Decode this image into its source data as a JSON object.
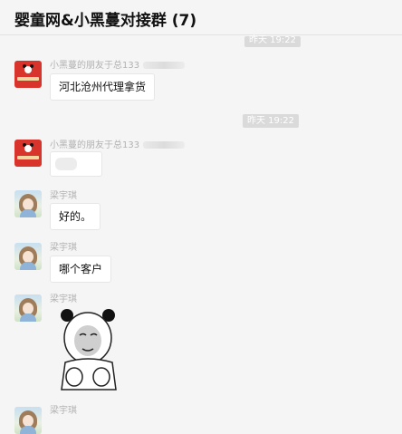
{
  "header": {
    "title": "婴童网&小黑蔓对接群 (7)"
  },
  "timestamps": [
    "昨天 19:22",
    "昨天 19:22"
  ],
  "messages": [
    {
      "sender": "小黑蔓的朋友于总133",
      "text": "河北沧州代理拿货"
    },
    {
      "sender": "小黑蔓的朋友于总133",
      "text": ""
    },
    {
      "sender": "梁宇琪",
      "text": "好的。"
    },
    {
      "sender": "梁宇琪",
      "text": "哪个客户"
    },
    {
      "sender": "梁宇琪",
      "text": ""
    },
    {
      "sender": "梁宇琪",
      "text": ""
    }
  ],
  "colors": {
    "background": "#f5f5f5",
    "bubble": "#ffffff",
    "timestamp_pill": "#dadada",
    "brand_avatar": "#d9342b"
  },
  "icons": {
    "brand_avatar": "brand-logo-avatar-icon",
    "user_avatar": "user-photo-avatar-icon",
    "sticker": "panda-meme-sticker-icon"
  }
}
